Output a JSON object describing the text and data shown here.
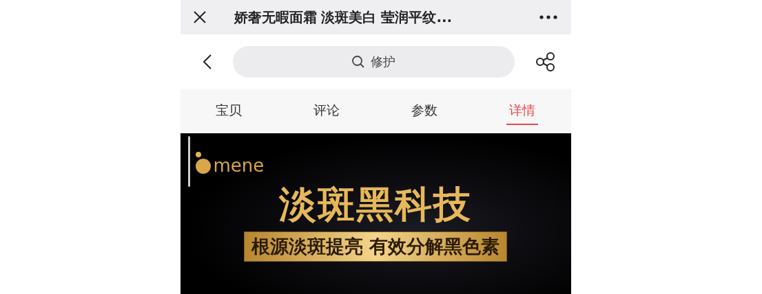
{
  "title_bar": {
    "title": "娇奢无暇面霜 淡斑美白 莹润平纹..."
  },
  "search": {
    "value": "修护"
  },
  "tabs": [
    {
      "label": "宝贝",
      "selected": false
    },
    {
      "label": "评论",
      "selected": false
    },
    {
      "label": "参数",
      "selected": false
    },
    {
      "label": "详情",
      "selected": true
    }
  ],
  "banner": {
    "logo": "mene",
    "headline": "淡斑黑科技",
    "tagline": "根源淡斑提亮  有效分解黑色素"
  }
}
